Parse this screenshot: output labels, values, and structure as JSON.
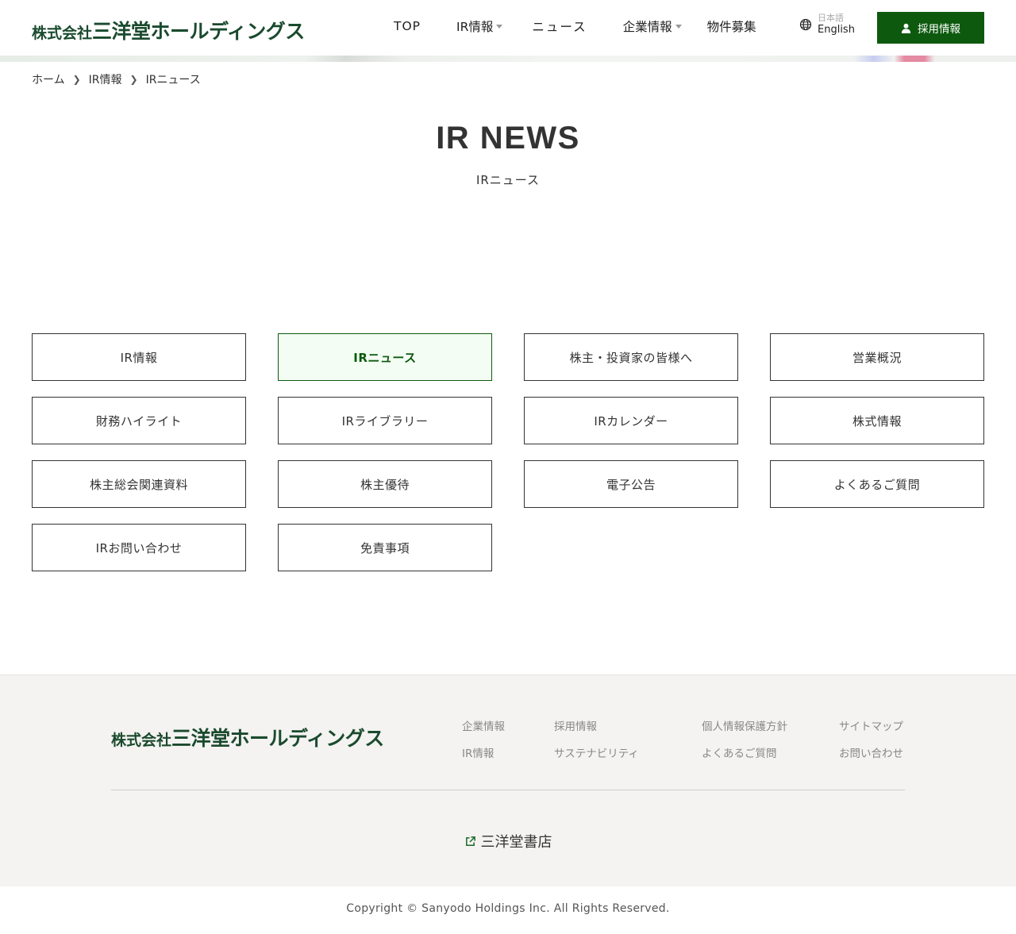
{
  "header": {
    "logo_small": "株式会社",
    "logo_big": "三洋堂ホールディングス",
    "nav": [
      {
        "label": "TOP",
        "dropdown": false
      },
      {
        "label": "IR情報",
        "dropdown": true
      },
      {
        "label": "ニュース",
        "dropdown": false
      },
      {
        "label": "企業情報",
        "dropdown": true
      },
      {
        "label": "物件募集",
        "dropdown": false
      }
    ],
    "lang_ja": "日本語",
    "lang_en": "English",
    "recruit_label": "採用情報",
    "accent_color": "#0d5a0f"
  },
  "breadcrumb": [
    "ホーム",
    "IR情報",
    "IRニュース"
  ],
  "page": {
    "title": "IR NEWS",
    "subtitle": "IRニュース"
  },
  "menu": [
    {
      "label": "IR情報",
      "active": false
    },
    {
      "label": "IRニュース",
      "active": true
    },
    {
      "label": "株主・投資家の皆様へ",
      "active": false
    },
    {
      "label": "営業概況",
      "active": false
    },
    {
      "label": "財務ハイライト",
      "active": false
    },
    {
      "label": "IRライブラリー",
      "active": false
    },
    {
      "label": "IRカレンダー",
      "active": false
    },
    {
      "label": "株式情報",
      "active": false
    },
    {
      "label": "株主総会関連資料",
      "active": false
    },
    {
      "label": "株主優待",
      "active": false
    },
    {
      "label": "電子公告",
      "active": false
    },
    {
      "label": "よくあるご質問",
      "active": false
    },
    {
      "label": "IRお問い合わせ",
      "active": false
    },
    {
      "label": "免責事項",
      "active": false
    }
  ],
  "footer": {
    "logo_small": "株式会社",
    "logo_big": "三洋堂ホールディングス",
    "links": [
      "企業情報",
      "IR情報",
      "採用情報",
      "サステナビリティ",
      "個人情報保護方針",
      "よくあるご質問",
      "サイトマップ",
      "お問い合わせ"
    ],
    "sister_site": "三洋堂書店",
    "copyright": "Copyright © Sanyodo Holdings Inc. All Rights Reserved."
  }
}
